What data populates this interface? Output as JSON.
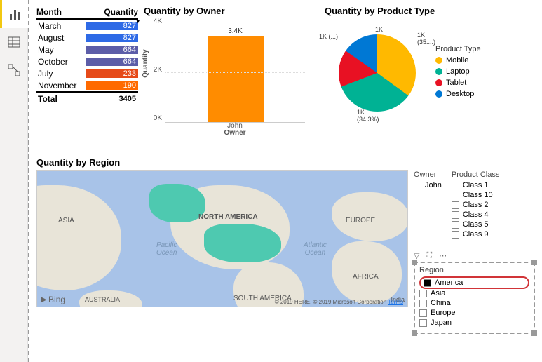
{
  "nav": {
    "items": [
      "report",
      "data",
      "model"
    ]
  },
  "table": {
    "headers": {
      "month": "Month",
      "qty": "Quantity"
    },
    "rows": [
      {
        "month": "March",
        "qty": "827",
        "bg": "#2e6ae6"
      },
      {
        "month": "August",
        "qty": "827",
        "bg": "#2e6ae6"
      },
      {
        "month": "May",
        "qty": "664",
        "bg": "#5c5da8"
      },
      {
        "month": "October",
        "qty": "664",
        "bg": "#5c5da8"
      },
      {
        "month": "July",
        "qty": "233",
        "bg": "#e64a19"
      },
      {
        "month": "November",
        "qty": "190",
        "bg": "#ff6a00"
      }
    ],
    "total": {
      "label": "Total",
      "value": "3405"
    }
  },
  "bar": {
    "title": "Quantity by Owner",
    "ylabel": "Quantity",
    "ticks": [
      "4K",
      "2K",
      "0K"
    ],
    "category": "John",
    "xlabel": "Owner",
    "valueLabel": "3.4K"
  },
  "pie": {
    "title": "Quantity by Product Type",
    "legendTitle": "Product Type",
    "items": [
      {
        "label": "Mobile",
        "color": "#ffb900"
      },
      {
        "label": "Laptop",
        "color": "#00b294"
      },
      {
        "label": "Tablet",
        "color": "#e81123"
      },
      {
        "label": "Desktop",
        "color": "#0078d4"
      }
    ],
    "dl_top": "1K",
    "dl_right": "1K\n(35....)",
    "dl_bottom": "1K\n(34.3%)",
    "dl_left": "1K (...)"
  },
  "map": {
    "title": "Quantity by Region",
    "labels": {
      "asia": "ASIA",
      "na": "NORTH AMERICA",
      "eu": "EUROPE",
      "africa": "AFRICA",
      "sa": "SOUTH AMERICA",
      "aus": "AUSTRALIA",
      "india": "India",
      "pacific": "Pacific\nOcean",
      "atlantic": "Atlantic\nOcean"
    },
    "bing": "Bing",
    "attrib": "© 2019 HERE, © 2019 Microsoft Corporation",
    "terms": "Terms"
  },
  "filters": {
    "owner": {
      "title": "Owner",
      "items": [
        "John"
      ]
    },
    "productClass": {
      "title": "Product Class",
      "items": [
        "Class 1",
        "Class 10",
        "Class 2",
        "Class 4",
        "Class 5",
        "Class 9"
      ]
    },
    "region": {
      "title": "Region",
      "items": [
        "America",
        "Asia",
        "China",
        "Europe",
        "Japan"
      ]
    }
  },
  "chart_data": [
    {
      "type": "table",
      "columns": [
        "Month",
        "Quantity"
      ],
      "rows": [
        [
          "March",
          827
        ],
        [
          "August",
          827
        ],
        [
          "May",
          664
        ],
        [
          "October",
          664
        ],
        [
          "July",
          233
        ],
        [
          "November",
          190
        ]
      ],
      "total": 3405
    },
    {
      "type": "bar",
      "title": "Quantity by Owner",
      "categories": [
        "John"
      ],
      "values": [
        3400
      ],
      "ylabel": "Quantity",
      "xlabel": "Owner",
      "ylim": [
        0,
        4000
      ]
    },
    {
      "type": "pie",
      "title": "Quantity by Product Type",
      "series": [
        {
          "name": "Mobile",
          "value": 1000,
          "pct": 35
        },
        {
          "name": "Laptop",
          "value": 1000,
          "pct": 34.3
        },
        {
          "name": "Tablet",
          "value": 1000,
          "pct": 15.4
        },
        {
          "name": "Desktop",
          "value": 1000,
          "pct": 15.3
        }
      ]
    }
  ]
}
